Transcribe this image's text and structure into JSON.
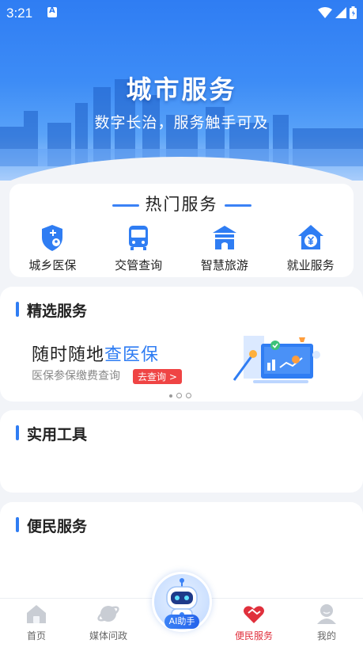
{
  "status": {
    "time": "3:21"
  },
  "hero": {
    "title": "城市服务",
    "subtitle": "数字长治，服务触手可及"
  },
  "hot": {
    "title": "热门服务",
    "items": [
      {
        "label": "城乡医保",
        "icon": "medical-shield-icon"
      },
      {
        "label": "交管查询",
        "icon": "bus-icon"
      },
      {
        "label": "智慧旅游",
        "icon": "gate-icon"
      },
      {
        "label": "就业服务",
        "icon": "yuan-house-icon"
      }
    ]
  },
  "selected": {
    "title": "精选服务",
    "banner_title_prefix": "随时随地",
    "banner_title_highlight": "查医保",
    "banner_sub": "医保参保缴费查询",
    "banner_button": "去查询 >"
  },
  "tools": {
    "title": "实用工具"
  },
  "convenient": {
    "title": "便民服务"
  },
  "nav": {
    "items": [
      {
        "label": "首页",
        "icon": "home-icon"
      },
      {
        "label": "媒体问政",
        "icon": "planet-icon"
      },
      {
        "label": "AI助手",
        "icon": "robot-icon"
      },
      {
        "label": "便民服务",
        "icon": "heart-hands-icon",
        "active": true
      },
      {
        "label": "我的",
        "icon": "user-icon"
      }
    ]
  },
  "colors": {
    "accent": "#2f7df3",
    "active": "#e0303c",
    "button": "#ef4444"
  }
}
